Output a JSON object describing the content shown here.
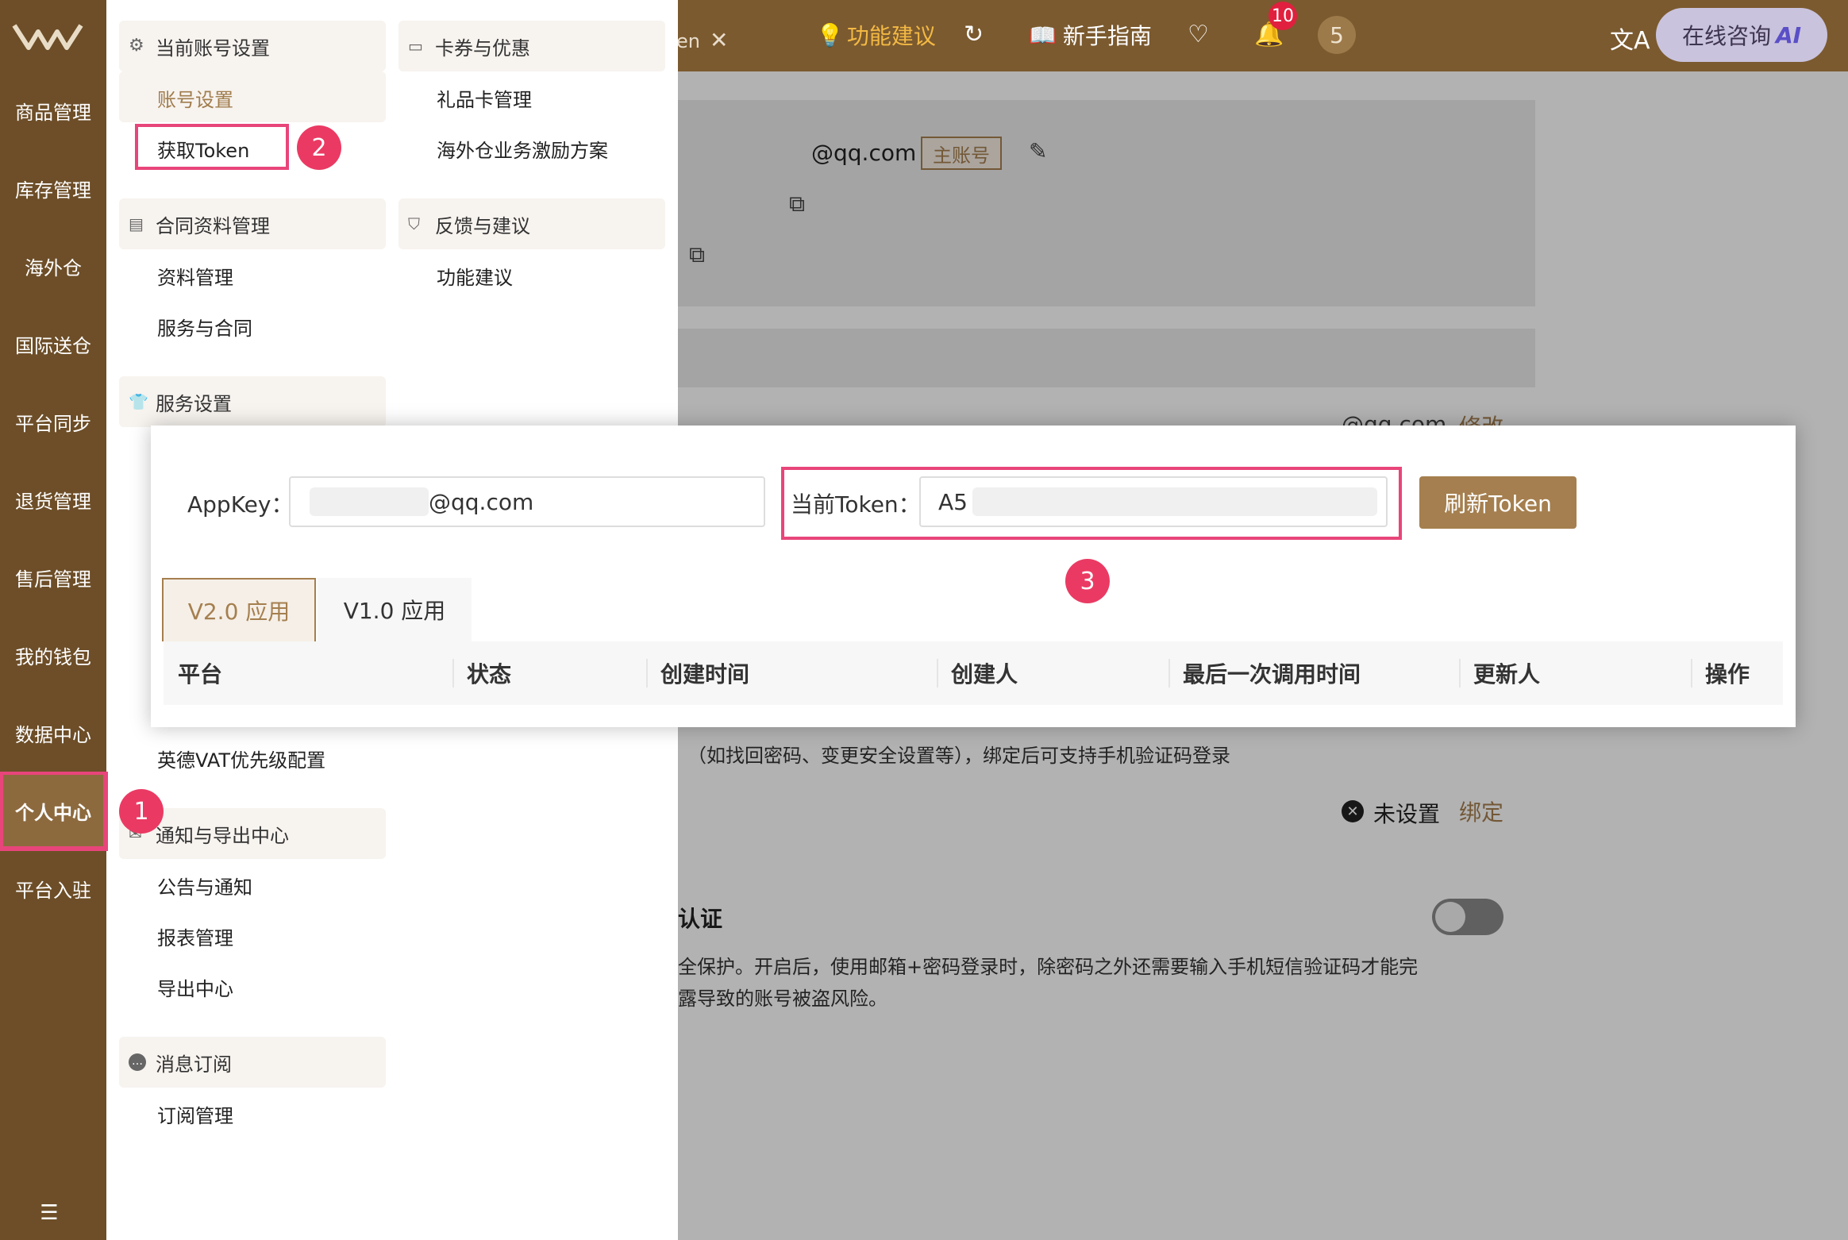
{
  "topbar": {
    "tab_fragment": "en",
    "suggest_label": "功能建议",
    "guide_label": "新手指南",
    "notif_count": "10",
    "avatar_count": "5",
    "consult_label": "在线咨询",
    "ai_label": "AI"
  },
  "rail": {
    "items": [
      "商品管理",
      "库存管理",
      "海外仓",
      "国际送仓",
      "平台同步",
      "退货管理",
      "售后管理",
      "我的钱包",
      "数据中心",
      "个人中心",
      "平台入驻"
    ]
  },
  "menu": {
    "col1": {
      "account_head": "当前账号设置",
      "account_settings": "账号设置",
      "get_token": "获取Token",
      "contract_head": "合同资料管理",
      "data_mgmt": "资料管理",
      "service_contract": "服务与合同",
      "service_head": "服务设置",
      "vat_config": "英德VAT优先级配置",
      "notify_head": "通知与导出中心",
      "announce": "公告与通知",
      "report_mgmt": "报表管理",
      "export_center": "导出中心",
      "msg_head": "消息订阅",
      "sub_mgmt": "订阅管理"
    },
    "col2": {
      "coupon_head": "卡券与优惠",
      "giftcard": "礼品卡管理",
      "overseas_incentive": "海外仓业务激励方案",
      "feedback_head": "反馈与建议",
      "feature_suggest": "功能建议"
    }
  },
  "steps": [
    "1",
    "2",
    "3"
  ],
  "background": {
    "email": "@qq.com",
    "main_badge": "主账号",
    "email2": "@qq.com",
    "modify": "修改",
    "security_hint": "（如找回密码、变更安全设置等），绑定后可支持手机验证码登录",
    "not_set": "未设置",
    "bind": "绑定",
    "auth_label": "认证",
    "auth_desc1": "全保护。开启后，使用邮箱+密码登录时，除密码之外还需要输入手机短信验证码才能完",
    "auth_desc2": "露导致的账号被盗风险。"
  },
  "token_panel": {
    "appkey_label": "AppKey：",
    "appkey_value": "@qq.com",
    "token_label": "当前Token：",
    "token_value": "A5",
    "refresh_button": "刷新Token",
    "tabs": [
      "V2.0 应用",
      "V1.0 应用"
    ],
    "columns": [
      "平台",
      "状态",
      "创建时间",
      "创建人",
      "最后一次调用时间",
      "更新人",
      "操作"
    ]
  },
  "colors": {
    "brand": "#6d4e28",
    "accent": "#a57f4f",
    "highlight": "#e8457a",
    "step_badge": "#ea3a63"
  }
}
